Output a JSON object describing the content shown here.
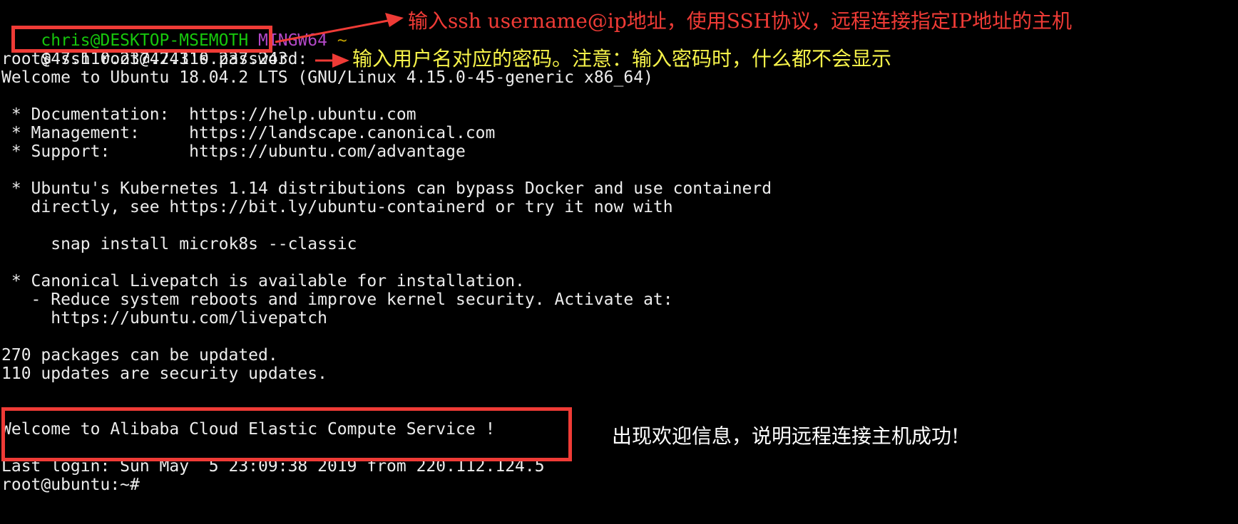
{
  "colors": {
    "background": "#000000",
    "foreground": "#ececec",
    "prompt_user": "#16c60c",
    "prompt_env": "#b148c6",
    "prompt_path": "#c1a100",
    "annotation_red": "#ef3b36",
    "annotation_yellow": "#f6f34a",
    "annotation_white": "#ffffff"
  },
  "terminal": {
    "prompt": {
      "user_host": "chris@DESKTOP-MSEMOTH",
      "env": "MINGW64",
      "path": "~",
      "symbol": "$",
      "command": "ssh root@47.110.237.243"
    },
    "lines": [
      "root@47.110.237.243's password:",
      "Welcome to Ubuntu 18.04.2 LTS (GNU/Linux 4.15.0-45-generic x86_64)",
      "",
      " * Documentation:  https://help.ubuntu.com",
      " * Management:     https://landscape.canonical.com",
      " * Support:        https://ubuntu.com/advantage",
      "",
      " * Ubuntu's Kubernetes 1.14 distributions can bypass Docker and use containerd",
      "   directly, see https://bit.ly/ubuntu-containerd or try it now with",
      "",
      "     snap install microk8s --classic",
      "",
      " * Canonical Livepatch is available for installation.",
      "   - Reduce system reboots and improve kernel security. Activate at:",
      "     https://ubuntu.com/livepatch",
      "",
      "270 packages can be updated.",
      "110 updates are security updates.",
      "",
      "",
      "Welcome to Alibaba Cloud Elastic Compute Service !",
      "",
      "Last login: Sun May  5 23:09:38 2019 from 220.112.124.5",
      "root@ubuntu:~#"
    ]
  },
  "annotations": {
    "ssh_note": "输入ssh username@ip地址，使用SSH协议，远程连接指定IP地址的主机",
    "password_note": "输入用户名对应的密码。注意：输入密码时，什么都不会显示",
    "welcome_note": "出现欢迎信息，说明远程连接主机成功!"
  }
}
